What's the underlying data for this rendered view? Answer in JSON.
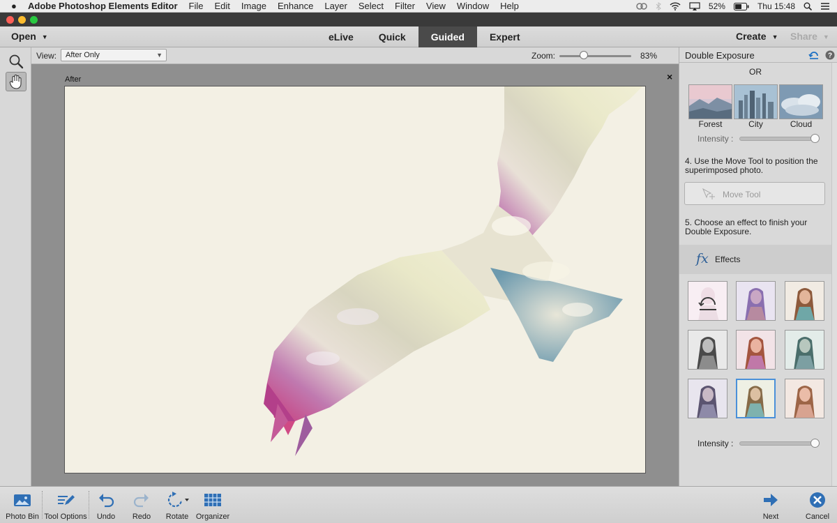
{
  "menubar": {
    "app_name": "Adobe Photoshop Elements Editor",
    "items": [
      "File",
      "Edit",
      "Image",
      "Enhance",
      "Layer",
      "Select",
      "Filter",
      "View",
      "Window",
      "Help"
    ],
    "battery": "52%",
    "clock": "Thu 15:48"
  },
  "toolbar": {
    "open_label": "Open",
    "modes": [
      "eLive",
      "Quick",
      "Guided",
      "Expert"
    ],
    "active_mode": "Guided",
    "create_label": "Create",
    "share_label": "Share"
  },
  "options": {
    "view_label": "View:",
    "view_value": "After Only",
    "zoom_label": "Zoom:",
    "zoom_value": "83%",
    "zoom_level": 0.33
  },
  "canvas": {
    "after_label": "After",
    "close_glyph": "×"
  },
  "panel": {
    "title": "Double Exposure",
    "or_text": "OR",
    "presets": [
      "Forest",
      "City",
      "Cloud"
    ],
    "intensity_label": "Intensity :",
    "preset_intensity": 1.0,
    "step4": "4. Use the Move Tool to position the superimposed photo.",
    "move_tool_label": "Move Tool",
    "step5": "5. Choose an effect to finish your Double Exposure.",
    "effects_label": "Effects",
    "effects_intensity": 1.0,
    "selected_effect_index": 7
  },
  "bottombar": {
    "photo_bin": "Photo Bin",
    "tool_options": "Tool Options",
    "undo": "Undo",
    "redo": "Redo",
    "rotate": "Rotate",
    "organizer": "Organizer",
    "next": "Next",
    "cancel": "Cancel"
  },
  "colors": {
    "accent": "#4a90d9",
    "active_mode_bg": "#4a4a4a",
    "canvas_bg": "#f3f0e4"
  }
}
